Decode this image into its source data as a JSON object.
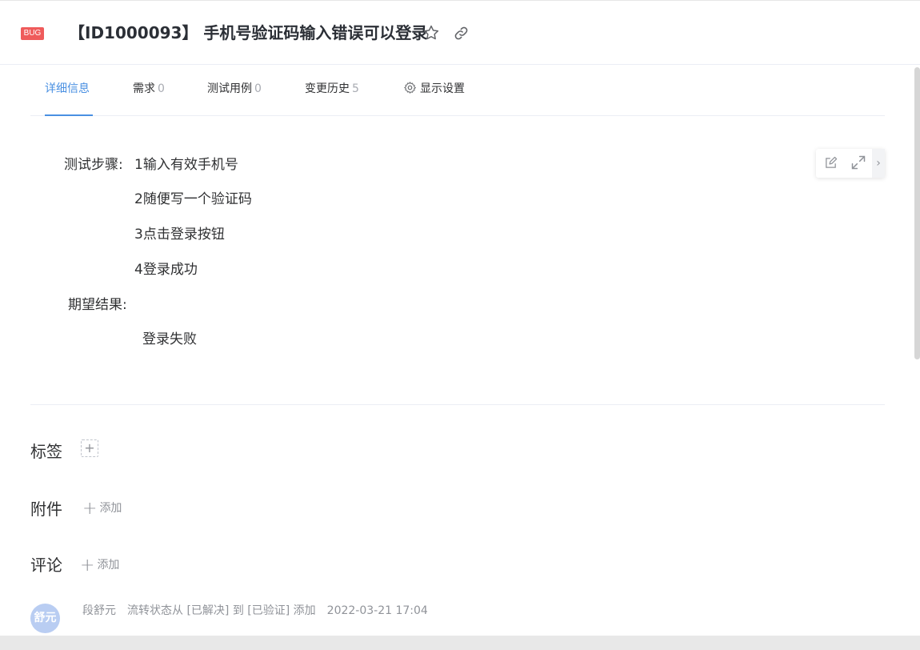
{
  "header": {
    "badge": "BUG",
    "title": "【ID1000093】 手机号验证码输入错误可以登录",
    "icons": {
      "favorite": "star-icon",
      "copy_link": "link-icon"
    },
    "badge_color": "#ef5b5b"
  },
  "tabs": [
    {
      "label": "详细信息",
      "count": "",
      "active": true
    },
    {
      "label": "需求",
      "count": "0",
      "active": false
    },
    {
      "label": "测试用例",
      "count": "0",
      "active": false
    },
    {
      "label": "变更历史",
      "count": "5",
      "active": false
    },
    {
      "label": "显示设置",
      "count": "",
      "active": false,
      "icon": "gear-icon"
    }
  ],
  "description": {
    "steps_label": "测试步骤:",
    "steps": [
      "1输入有效手机号",
      "2随便写一个验证码",
      "3点击登录按钮",
      "4登录成功"
    ],
    "expected_label": "期望结果:",
    "expected": "登录失败",
    "toolbar_icons": [
      "edit-icon",
      "expand-icon",
      "chevron-right-icon"
    ]
  },
  "sections": {
    "tags_label": "标签",
    "tag_add_symbol": "+",
    "attachments_label": "附件",
    "attachments_add": "添加",
    "comments_label": "评论",
    "comments_add": "添加"
  },
  "activity": {
    "avatar_text": "舒元",
    "user": "段舒元",
    "action": "流转状态从 [已解决] 到 [已验证] 添加",
    "time": "2022-03-21 17:04"
  },
  "colors": {
    "accent": "#4a90e2",
    "muted": "#909399",
    "avatar_bg": "#b9cdf2"
  }
}
